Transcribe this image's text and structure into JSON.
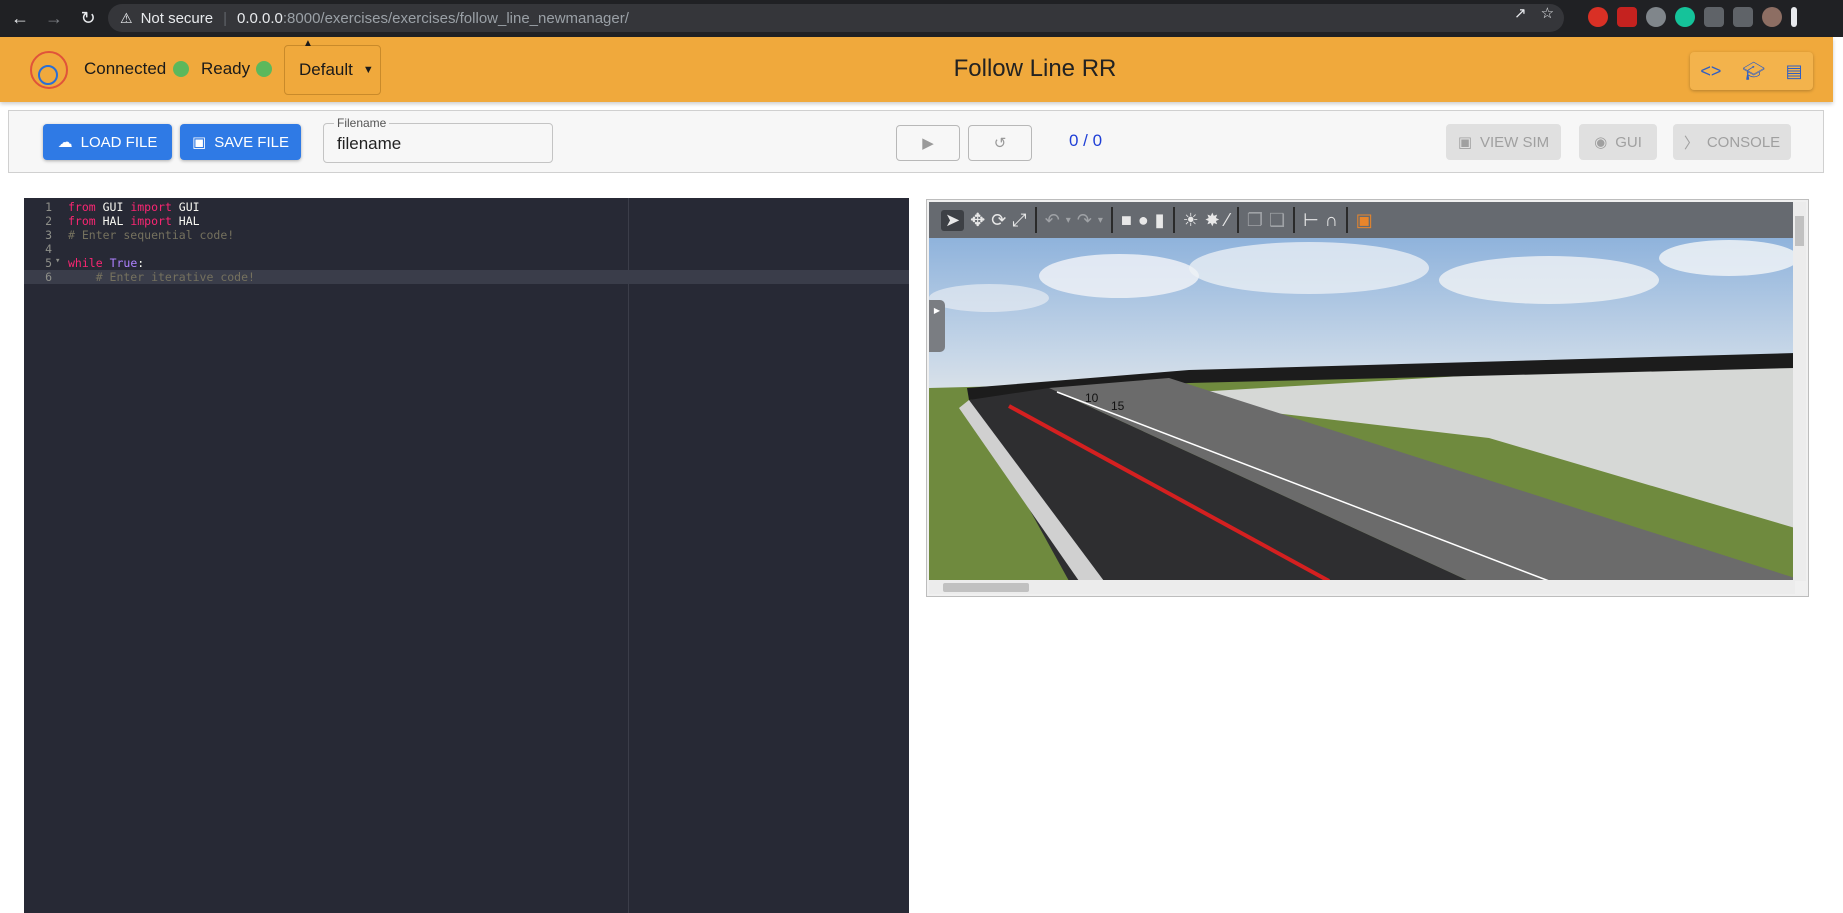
{
  "browser": {
    "security_label": "Not secure",
    "url_host": "0.0.0.0",
    "url_path": ":8000/exercises/exercises/follow_line_newmanager/"
  },
  "header": {
    "status_connected": "Connected",
    "status_ready": "Ready",
    "world_select": "Default",
    "title": "Follow Line RR",
    "status_color": "#5cb85c",
    "accent": "#f0a93c"
  },
  "toolbar": {
    "load_label": "LOAD FILE",
    "save_label": "SAVE FILE",
    "filename_label": "Filename",
    "filename_value": "filename",
    "counter": "0 / 0",
    "view_sim_label": "VIEW SIM",
    "gui_label": "GUI",
    "console_label": "CONSOLE"
  },
  "editor": {
    "lines": [
      {
        "n": "1",
        "text": "from GUI import GUI"
      },
      {
        "n": "2",
        "text": "from HAL import HAL"
      },
      {
        "n": "3",
        "text": "# Enter sequential code!"
      },
      {
        "n": "4",
        "text": ""
      },
      {
        "n": "5",
        "text": "while True:"
      },
      {
        "n": "6",
        "text": "    # Enter iterative code!"
      }
    ]
  },
  "scene": {
    "marker_10": "10",
    "marker_15": "15"
  }
}
